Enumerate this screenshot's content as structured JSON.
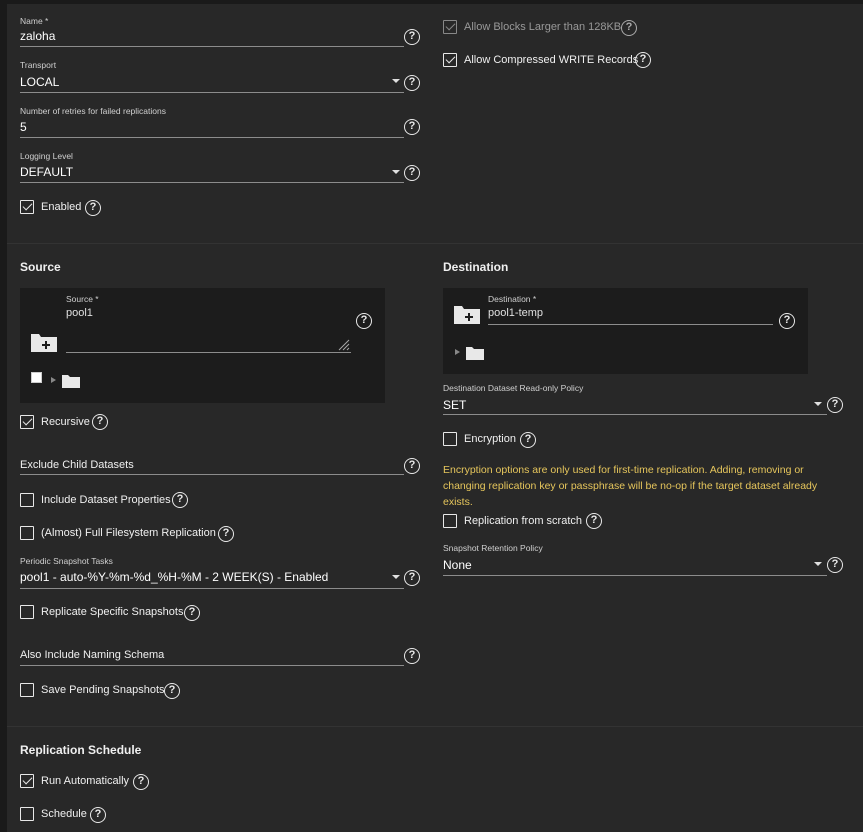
{
  "general": {
    "name_label": "Name *",
    "name_value": "zaloha",
    "transport_label": "Transport",
    "transport_value": "LOCAL",
    "retries_label": "Number of retries for failed replications",
    "retries_value": "5",
    "logging_label": "Logging Level",
    "logging_value": "DEFAULT",
    "enabled_label": "Enabled",
    "allow_blocks_label": "Allow Blocks Larger than 128KB",
    "allow_compressed_label": "Allow Compressed WRITE Records"
  },
  "source": {
    "title": "Source",
    "field_label": "Source *",
    "field_value": "pool1",
    "recursive_label": "Recursive",
    "exclude_label": "Exclude Child Datasets",
    "include_props_label": "Include Dataset Properties",
    "full_fs_label": "(Almost) Full Filesystem Replication",
    "periodic_label": "Periodic Snapshot Tasks",
    "periodic_value": "pool1 - auto-%Y-%m-%d_%H-%M - 2 WEEK(S) - Enabled",
    "replicate_specific_label": "Replicate Specific Snapshots",
    "naming_schema_label": "Also Include Naming Schema",
    "save_pending_label": "Save Pending Snapshots"
  },
  "destination": {
    "title": "Destination",
    "field_label": "Destination *",
    "field_value": "pool1-temp",
    "readonly_label": "Destination Dataset Read-only Policy",
    "readonly_value": "SET",
    "encryption_label": "Encryption",
    "encryption_warning": "Encryption options are only used for first-time replication. Adding, removing or changing replication key or passphrase will be no-op if the target dataset already exists.",
    "scratch_label": "Replication from scratch",
    "retention_label": "Snapshot Retention Policy",
    "retention_value": "None"
  },
  "schedule": {
    "title": "Replication Schedule",
    "run_auto_label": "Run Automatically",
    "schedule_label": "Schedule"
  },
  "help_glyph": "?",
  "colors": {
    "background": "#282828",
    "warning": "#e6c65c",
    "explorer": "#1c1c1c"
  }
}
